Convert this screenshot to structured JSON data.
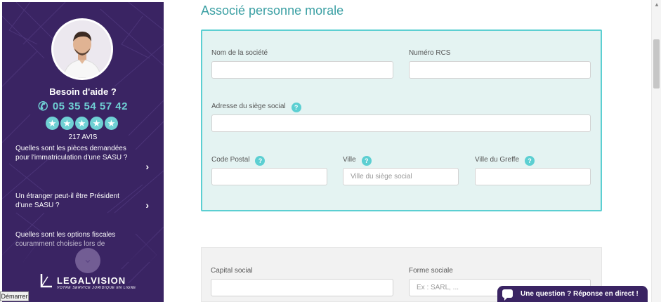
{
  "sidebar": {
    "help_title": "Besoin d'aide ?",
    "phone": "05 35 54 57 42",
    "stars": [
      "★",
      "★",
      "★",
      "★",
      "★"
    ],
    "reviews": "217 AVIS",
    "faq": [
      {
        "text": "Quelles sont les pièces demandées pour l'immatriculation d'une SASU ?",
        "arrow": "›"
      },
      {
        "text": "Un étranger peut-il être Président d'une SASU ?",
        "arrow": "›"
      },
      {
        "text": "Quelles sont les options fiscales couramment choisies lors de",
        "arrow": ""
      }
    ],
    "scroll_down": "⌄",
    "logo_text": "LEGALVISION",
    "logo_sub": "VOTRE SERVICE JURIDIQUE EN LIGNE",
    "start_button": "Démarrer"
  },
  "main": {
    "title": "Associé personne morale",
    "fields": {
      "company_name": {
        "label": "Nom de la société",
        "value": "",
        "placeholder": ""
      },
      "rcs_number": {
        "label": "Numéro RCS",
        "value": "",
        "placeholder": ""
      },
      "address": {
        "label": "Adresse du siège social",
        "value": "",
        "placeholder": ""
      },
      "postal_code": {
        "label": "Code Postal",
        "value": "",
        "placeholder": ""
      },
      "city": {
        "label": "Ville",
        "value": "",
        "placeholder": "Ville du siège social"
      },
      "registry_city": {
        "label": "Ville du Greffe",
        "value": "",
        "placeholder": ""
      },
      "share_capital": {
        "label": "Capital social",
        "value": "",
        "placeholder": ""
      },
      "legal_form": {
        "label": "Forme sociale",
        "value": "",
        "placeholder": "Ex : SARL, ..."
      }
    },
    "help_icon": "?"
  },
  "chat": {
    "label": "Une question ? Réponse en direct !"
  },
  "colors": {
    "sidebar_bg": "#3a2463",
    "accent": "#5ccfd2",
    "title": "#3a9fa3",
    "card_bg": "#e4f3f2"
  }
}
